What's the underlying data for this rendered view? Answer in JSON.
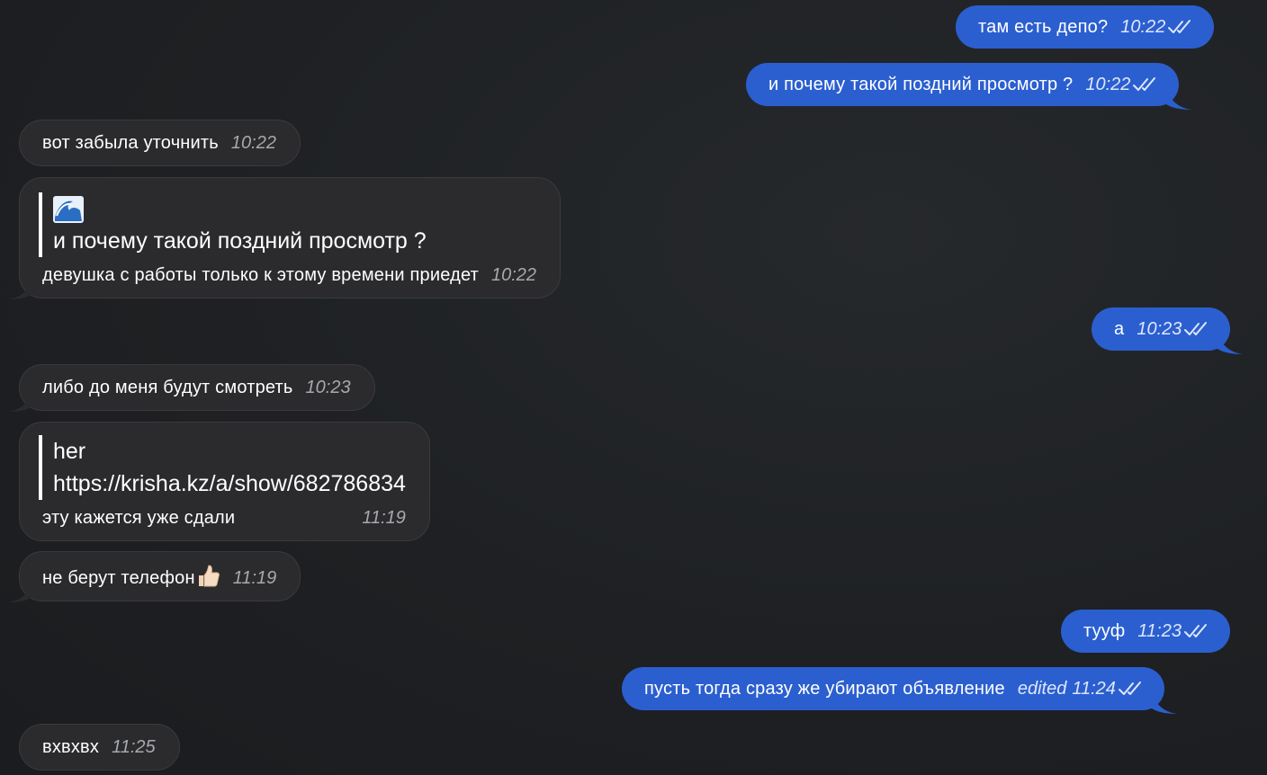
{
  "messages": [
    {
      "text": "там есть депо?",
      "time": "10:22"
    },
    {
      "text": "и почему такой поздний просмотр ?",
      "time": "10:22"
    },
    {
      "text": "вот забыла уточнить",
      "time": "10:22"
    },
    {
      "quote_emoji": "🌊",
      "quote_text": "и почему такой поздний просмотр ?",
      "text": "девушка с работы только к этому времени приедет",
      "time": "10:22"
    },
    {
      "text": "а",
      "time": "10:23"
    },
    {
      "text": "либо до меня будут смотреть",
      "time": "10:23"
    },
    {
      "quote_title": "her",
      "quote_text": "https://krisha.kz/a/show/682786834",
      "text": "эту кажется уже сдали",
      "time": "11:19"
    },
    {
      "text": "не берут телефон",
      "emoji": "👍🏻",
      "time": "11:19"
    },
    {
      "text": "тууф",
      "time": "11:23"
    },
    {
      "text": "пусть тогда сразу же убирают объявление",
      "edited": "edited",
      "time": "11:24"
    },
    {
      "text": "вхвхвх",
      "time": "11:25"
    }
  ],
  "colors": {
    "background": "#1f2124",
    "incoming_bubble": "#2b2b2d",
    "outgoing_bubble": "#2b5fd0",
    "timestamp": "#a6a9ae"
  },
  "icons": {
    "read_receipt": "double-check-icon",
    "wave": "wave-emoji-icon",
    "thumbs_up": "thumbs-up-emoji-icon"
  }
}
